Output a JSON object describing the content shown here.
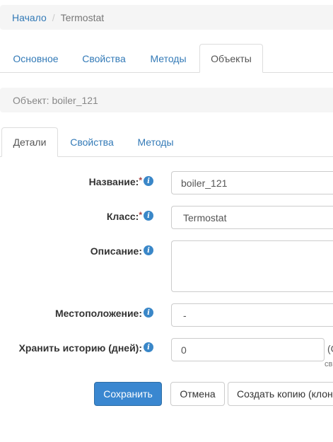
{
  "breadcrumb": {
    "home": "Начало",
    "separator": "/",
    "current": "Termostat"
  },
  "main_tabs": [
    {
      "label": "Основное"
    },
    {
      "label": "Свойства"
    },
    {
      "label": "Методы"
    },
    {
      "label": "Объекты"
    }
  ],
  "object_header": "Объект: boiler_121",
  "sub_tabs": [
    {
      "label": "Детали"
    },
    {
      "label": "Свойства"
    },
    {
      "label": "Методы"
    }
  ],
  "form": {
    "name": {
      "label": "Название:",
      "required": "*",
      "value": "boiler_121"
    },
    "class": {
      "label": "Класс:",
      "required": "*",
      "value": "Termostat"
    },
    "description": {
      "label": "Описание:",
      "value": ""
    },
    "location": {
      "label": "Местоположение:",
      "value": "-"
    },
    "history": {
      "label": "Хранить историю (дней):",
      "value": "0",
      "suffix": "(С",
      "suffix2": "св"
    }
  },
  "buttons": {
    "save": "Сохранить",
    "cancel": "Отмена",
    "copy": "Создать копию (клон"
  },
  "colors": {
    "link": "#337ab7",
    "primary": "#3a87d0",
    "info": "#3a87c8",
    "required": "#a94442"
  }
}
